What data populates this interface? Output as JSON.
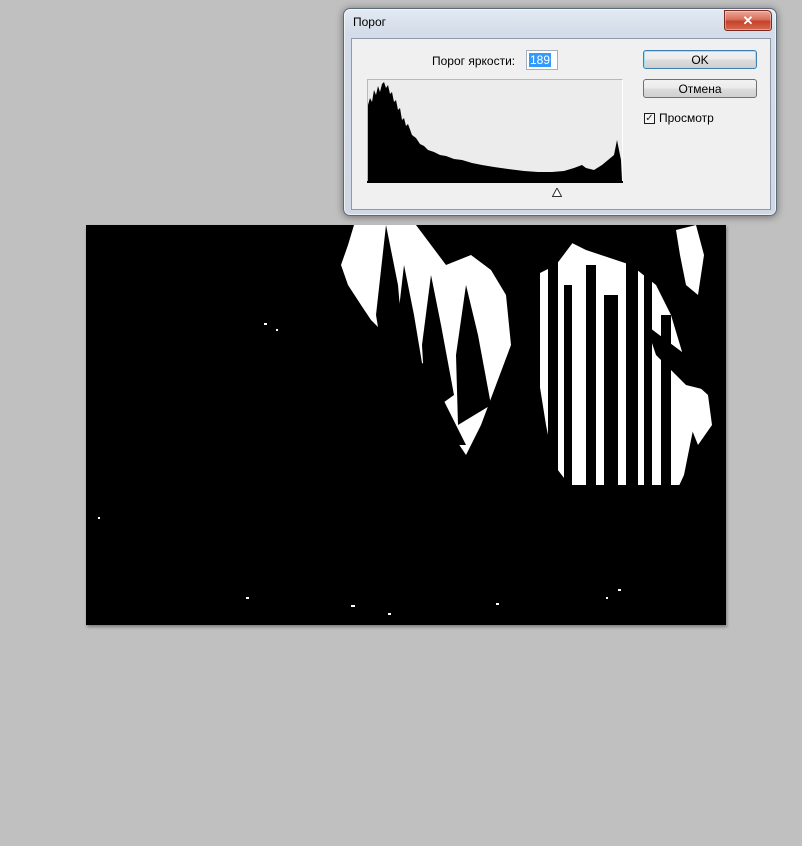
{
  "dialog": {
    "title": "Порог",
    "close_icon": "close-icon",
    "threshold_label": "Порог яркости:",
    "threshold_value": "189",
    "ok_label": "OK",
    "cancel_label": "Отмена",
    "preview_label": "Просмотр",
    "preview_checked": true,
    "slider_value": 189,
    "slider_max": 255
  },
  "colors": {
    "workspace": "#c0c0c0",
    "image_black": "#000000",
    "image_white": "#ffffff",
    "selection": "#3399ff"
  }
}
